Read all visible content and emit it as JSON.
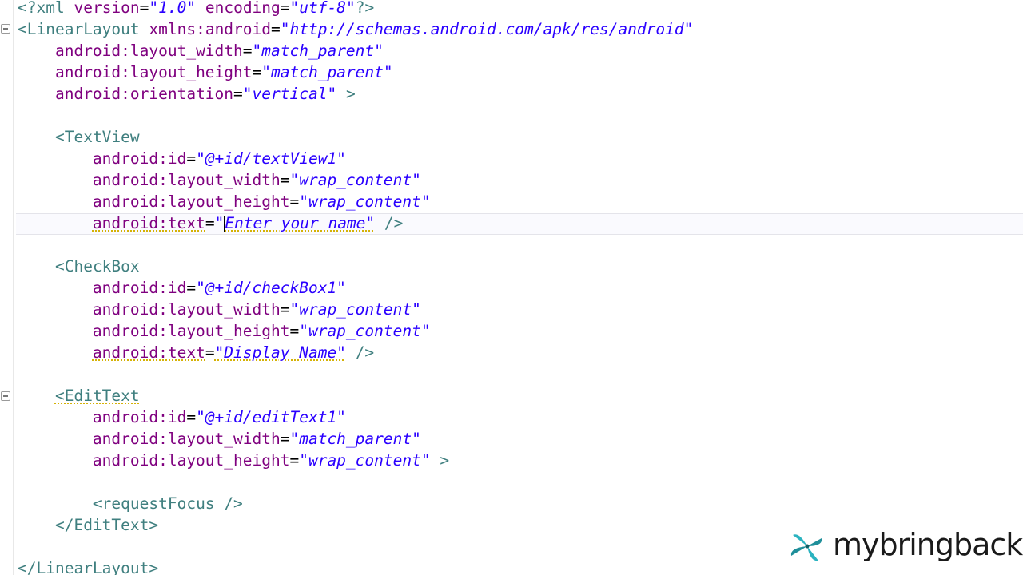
{
  "code": {
    "l1": {
      "open": "<?",
      "tag": "xml",
      "a1": "version",
      "v1": "\"1.0\"",
      "a2": "encoding",
      "v2": "\"utf-8\"",
      "close": "?>"
    },
    "l2": {
      "open": "<",
      "tag": "LinearLayout",
      "attr": "xmlns:android",
      "val": "\"http://schemas.android.com/apk/res/android\""
    },
    "l3": {
      "attr": "android:layout_width",
      "val": "\"match_parent\""
    },
    "l4": {
      "attr": "android:layout_height",
      "val": "\"match_parent\""
    },
    "l5": {
      "attr": "android:orientation",
      "val": "\"vertical\"",
      "close": ">"
    },
    "l7": {
      "open": "<",
      "tag": "TextView"
    },
    "l8": {
      "attr": "android:id",
      "val": "\"@+id/textView1\""
    },
    "l9": {
      "attr": "android:layout_width",
      "val": "\"wrap_content\""
    },
    "l10": {
      "attr": "android:layout_height",
      "val": "\"wrap_content\""
    },
    "l11": {
      "attr": "android:text",
      "q1": "\"",
      "val": "Enter your name\"",
      "close": "/>"
    },
    "l13": {
      "open": "<",
      "tag": "CheckBox"
    },
    "l14": {
      "attr": "android:id",
      "val": "\"@+id/checkBox1\""
    },
    "l15": {
      "attr": "android:layout_width",
      "val": "\"wrap_content\""
    },
    "l16": {
      "attr": "android:layout_height",
      "val": "\"wrap_content\""
    },
    "l17": {
      "attr": "android:text",
      "val": "\"Display Name\"",
      "close": "/>"
    },
    "l19": {
      "open": "<",
      "tag": "EditText"
    },
    "l20": {
      "attr": "android:id",
      "val": "\"@+id/editText1\""
    },
    "l21": {
      "attr": "android:layout_width",
      "val": "\"match_parent\""
    },
    "l22": {
      "attr": "android:layout_height",
      "val": "\"wrap_content\"",
      "close": ">"
    },
    "l24": {
      "open": "<",
      "tag": "requestFocus",
      "close": "/>"
    },
    "l25": {
      "open": "</",
      "tag": "EditText",
      "close": ">"
    },
    "l27": {
      "open": "</",
      "tag": "LinearLayout",
      "close": ">"
    }
  },
  "watermark": {
    "text": "mybringback"
  },
  "colors": {
    "tag": "#3f7f7f",
    "attribute": "#7f007f",
    "value": "#2a00ff",
    "warning_underline": "#d4b000",
    "logo_accent": "#2bb3c0"
  }
}
